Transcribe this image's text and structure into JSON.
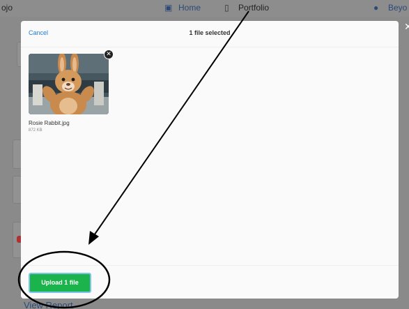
{
  "background": {
    "nav": {
      "brand": "ojo",
      "home": "Home",
      "portfolio": "Portfolio",
      "beyond": "Beyo"
    },
    "view_report": "View Report"
  },
  "modal": {
    "cancel_label": "Cancel",
    "title": "1 file selected",
    "file": {
      "name": "Rosie Rabbit.jpg",
      "size": "872 KB"
    },
    "upload_label": "Upload 1 file"
  },
  "colors": {
    "accent_link": "#1d7bd6",
    "upload_green": "#1bb34b"
  },
  "icons": {
    "home": "home-icon",
    "portfolio": "portfolio-icon",
    "user": "user-icon",
    "remove": "close-icon"
  }
}
